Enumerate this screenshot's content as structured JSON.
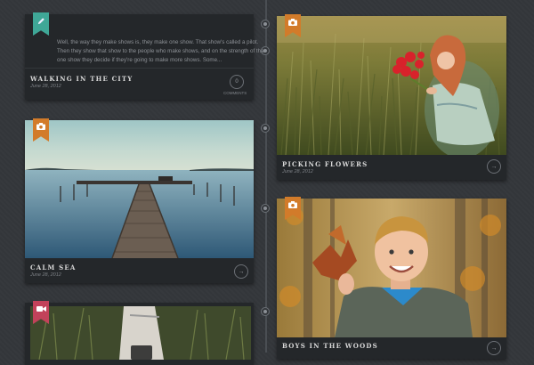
{
  "colors": {
    "background": "#34373b",
    "card": "#24272a",
    "ribbon_teal": "#3fa797",
    "ribbon_orange": "#d27b2a",
    "ribbon_red": "#c2425a"
  },
  "posts": [
    {
      "title": "WALKING IN THE CITY",
      "date": "June 28, 2012",
      "ribbon_icon": "pencil-icon",
      "excerpt": "Well, the way they make shows is, they make one show. That show's called a pilot. Then they show that show to the people who make shows, and on the strength of that one show they decide if they're going to make more shows. Some...",
      "comments_count": "0",
      "comments_label": "COMMENTS"
    },
    {
      "title": "PICKING FLOWERS",
      "date": "June 28, 2012",
      "ribbon_icon": "camera-icon",
      "image": "girl-in-field-with-red-flowers"
    },
    {
      "title": "CALM SEA",
      "date": "June 28, 2012",
      "ribbon_icon": "camera-icon",
      "image": "wooden-pier-on-calm-lake"
    },
    {
      "title": "BOYS IN THE WOODS",
      "date": "",
      "ribbon_icon": "camera-icon",
      "image": "boy-holding-autumn-leaves"
    },
    {
      "title": "",
      "date": "",
      "ribbon_icon": "video-camera-icon",
      "image": "video-still-grass"
    }
  ]
}
